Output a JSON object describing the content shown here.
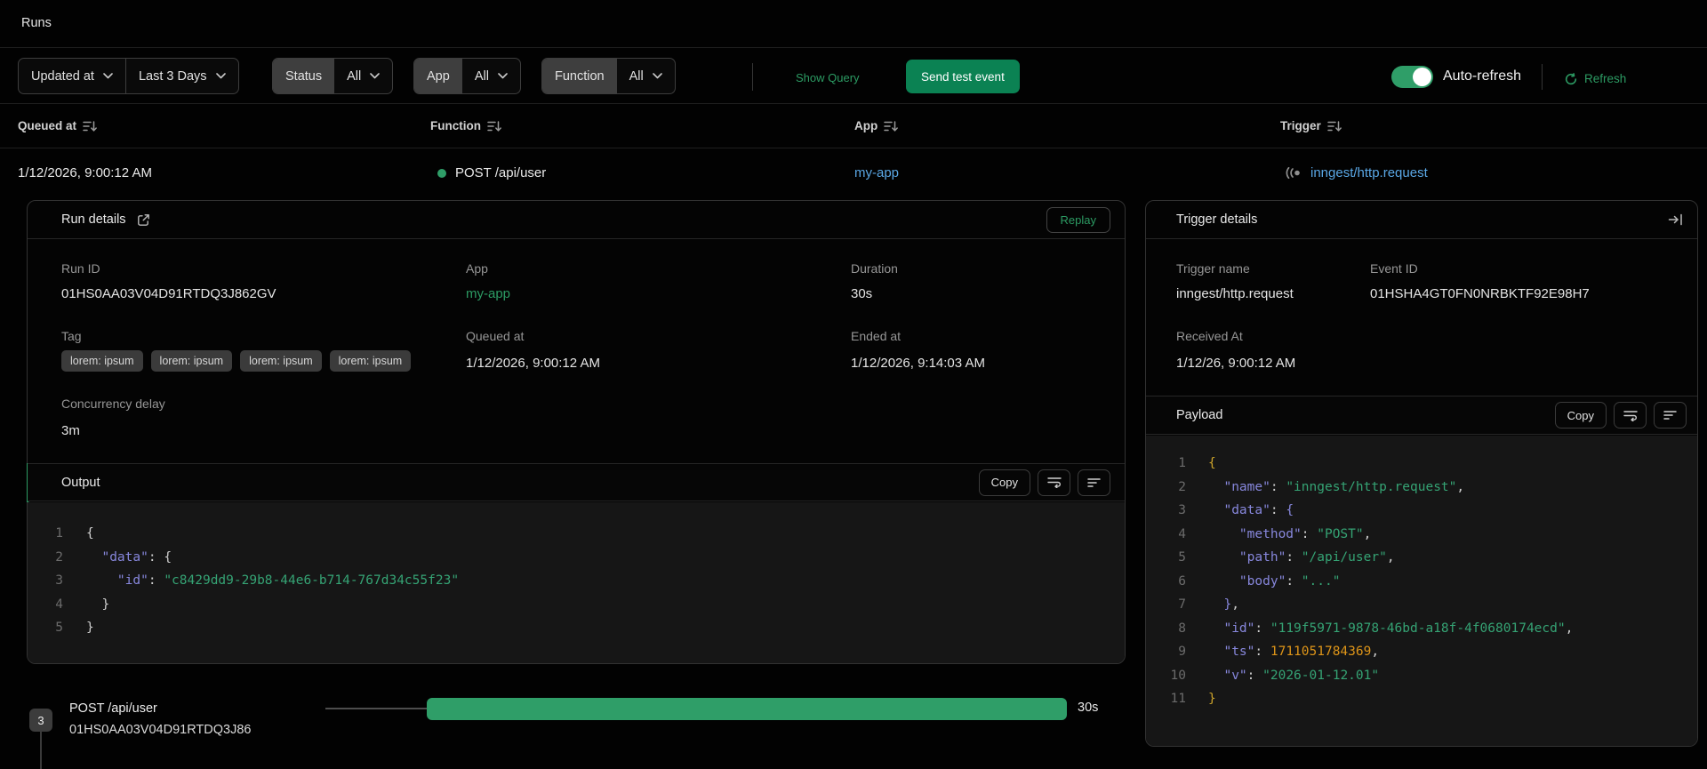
{
  "page": {
    "title": "Runs"
  },
  "filters": {
    "sort_field": "Updated at",
    "time_range": "Last 3 Days",
    "groups": [
      {
        "label": "Status",
        "value": "All"
      },
      {
        "label": "App",
        "value": "All"
      },
      {
        "label": "Function",
        "value": "All"
      }
    ],
    "show_query": "Show Query",
    "send_test_event": "Send test event",
    "auto_refresh": "Auto-refresh",
    "refresh": "Refresh"
  },
  "table": {
    "headers": [
      "Queued at",
      "Function",
      "App",
      "Trigger"
    ],
    "row": {
      "queued_at": "1/12/2026, 9:00:12 AM",
      "function": "POST /api/user",
      "app": "my-app",
      "trigger": "inngest/http.request"
    }
  },
  "run_details": {
    "title": "Run details",
    "replay": "Replay",
    "run_id_label": "Run ID",
    "run_id": "01HS0AA03V04D91RTDQ3J862GV",
    "app_label": "App",
    "app": "my-app",
    "duration_label": "Duration",
    "duration": "30s",
    "tag_label": "Tag",
    "tag_chips": [
      "lorem: ipsum",
      "lorem: ipsum",
      "lorem: ipsum",
      "lorem: ipsum"
    ],
    "queued_at_label": "Queued at",
    "queued_at": "1/12/2026, 9:00:12 AM",
    "ended_at_label": "Ended at",
    "ended_at": "1/12/2026, 9:14:03 AM",
    "concurrency_label": "Concurrency delay",
    "concurrency": "3m",
    "output": {
      "title": "Output",
      "copy": "Copy",
      "code_lines": [
        [
          [
            "p",
            "{"
          ]
        ],
        [
          [
            "p",
            "  "
          ],
          [
            "k",
            "\"data\""
          ],
          [
            "p",
            ": {"
          ]
        ],
        [
          [
            "p",
            "    "
          ],
          [
            "k",
            "\"id\""
          ],
          [
            "p",
            ": "
          ],
          [
            "s",
            "\"c8429dd9-29b8-44e6-b714-767d34c55f23\""
          ]
        ],
        [
          [
            "p",
            "  }"
          ]
        ],
        [
          [
            "p",
            "}"
          ]
        ]
      ]
    }
  },
  "trigger_details": {
    "title": "Trigger details",
    "trigger_name_label": "Trigger name",
    "trigger_name": "inngest/http.request",
    "event_id_label": "Event ID",
    "event_id": "01HSHA4GT0FN0NRBKTF92E98H7",
    "received_at_label": "Received At",
    "received_at": "1/12/26, 9:00:12 AM",
    "payload": {
      "title": "Payload",
      "copy": "Copy",
      "code_lines": [
        [
          [
            "g",
            "{"
          ]
        ],
        [
          [
            "p",
            "  "
          ],
          [
            "k",
            "\"name\""
          ],
          [
            "p",
            ": "
          ],
          [
            "s",
            "\"inngest/http.request\""
          ],
          [
            "p",
            ","
          ]
        ],
        [
          [
            "p",
            "  "
          ],
          [
            "k",
            "\"data\""
          ],
          [
            "p",
            ": "
          ],
          [
            "b",
            "{"
          ]
        ],
        [
          [
            "p",
            "    "
          ],
          [
            "k",
            "\"method\""
          ],
          [
            "p",
            ": "
          ],
          [
            "s",
            "\"POST\""
          ],
          [
            "p",
            ","
          ]
        ],
        [
          [
            "p",
            "    "
          ],
          [
            "k",
            "\"path\""
          ],
          [
            "p",
            ": "
          ],
          [
            "s",
            "\"/api/user\""
          ],
          [
            "p",
            ","
          ]
        ],
        [
          [
            "p",
            "    "
          ],
          [
            "k",
            "\"body\""
          ],
          [
            "p",
            ": "
          ],
          [
            "s",
            "\"...\""
          ]
        ],
        [
          [
            "p",
            "  "
          ],
          [
            "b",
            "}"
          ],
          [
            "p",
            ","
          ]
        ],
        [
          [
            "p",
            "  "
          ],
          [
            "k",
            "\"id\""
          ],
          [
            "p",
            ": "
          ],
          [
            "s",
            "\"119f5971-9878-46bd-a18f-4f0680174ecd\""
          ],
          [
            "p",
            ","
          ]
        ],
        [
          [
            "p",
            "  "
          ],
          [
            "k",
            "\"ts\""
          ],
          [
            "p",
            ": "
          ],
          [
            "n",
            "1711051784369"
          ],
          [
            "p",
            ","
          ]
        ],
        [
          [
            "p",
            "  "
          ],
          [
            "k",
            "\"v\""
          ],
          [
            "p",
            ": "
          ],
          [
            "s",
            "\"2026-01-12.01\""
          ]
        ],
        [
          [
            "g",
            "}"
          ]
        ]
      ]
    }
  },
  "timeline": {
    "count": "3",
    "step_name": "POST /api/user",
    "step_id": "01HS0AA03V04D91RTDQ3J86",
    "duration": "30s"
  },
  "colors": {
    "accent_green": "#2c9b63",
    "button_green": "#0b8253",
    "toggle_green": "#2f9e68",
    "bar_green": "#2f9e68",
    "status_dot": "#2f9e68",
    "link_blue": "#5aa7e5",
    "code_key": "#8787dc",
    "code_string": "#35a374",
    "code_number": "#dd9418",
    "code_bracket_gold": "#cba22a"
  }
}
